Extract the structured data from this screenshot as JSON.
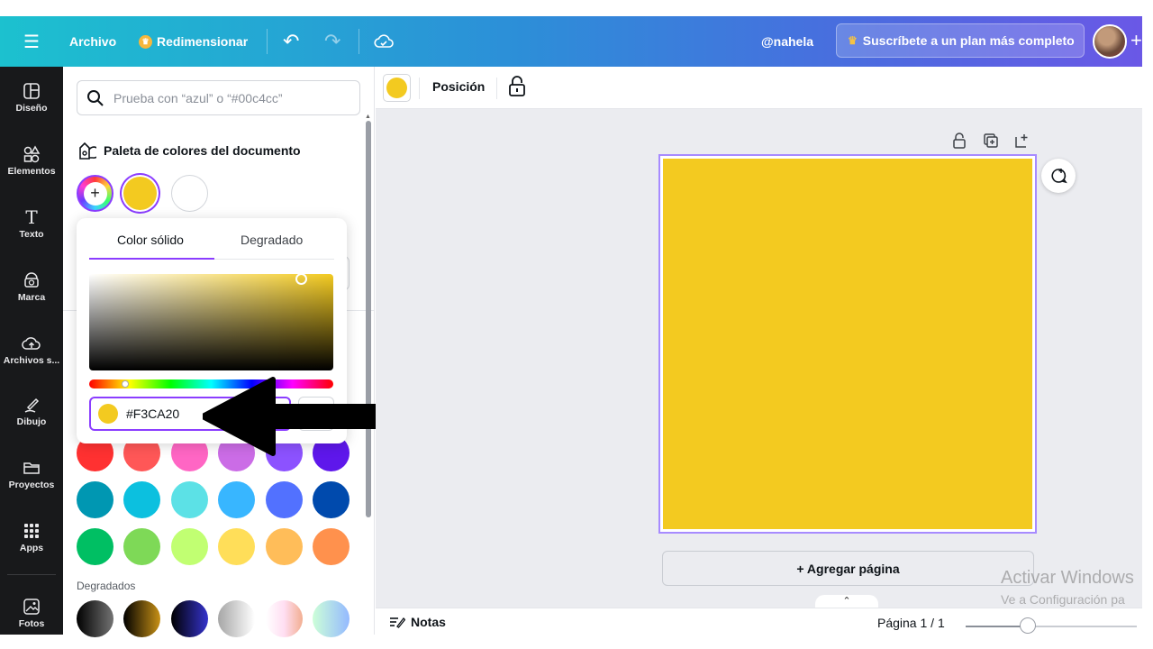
{
  "topbar": {
    "archivo": "Archivo",
    "redimensionar": "Redimensionar",
    "username": "@nahela",
    "subscribe": "Suscríbete a un plan más completo"
  },
  "sidebar": {
    "items": [
      {
        "label": "Diseño",
        "icon": "layout-icon"
      },
      {
        "label": "Elementos",
        "icon": "shapes-icon"
      },
      {
        "label": "Texto",
        "icon": "text-icon"
      },
      {
        "label": "Marca",
        "icon": "brand-icon"
      },
      {
        "label": "Archivos s...",
        "icon": "cloud-upload-icon"
      },
      {
        "label": "Dibujo",
        "icon": "pen-icon"
      },
      {
        "label": "Proyectos",
        "icon": "folder-icon"
      },
      {
        "label": "Apps",
        "icon": "apps-grid-icon"
      },
      {
        "label": "Fotos",
        "icon": "image-icon"
      }
    ]
  },
  "panel": {
    "search_placeholder": "Prueba con “azul” o “#00c4cc”",
    "palette_title": "Paleta de colores del documento",
    "degradados_label": "Degradados",
    "document_colors": [
      "#f3ca20",
      "#ffffff"
    ],
    "default_colors": [
      [
        "#ff3131",
        "#ff5757",
        "#ff66c4",
        "#cb6ce6",
        "#8c52ff",
        "#5e17eb"
      ],
      [
        "#0097b2",
        "#0cc0df",
        "#5ce1e6",
        "#38b6ff",
        "#5271ff",
        "#004aad"
      ],
      [
        "#00bf63",
        "#7ed957",
        "#c1ff72",
        "#ffde59",
        "#ffbd59",
        "#ff914d"
      ]
    ]
  },
  "picker": {
    "tab_solid": "Color sólido",
    "tab_gradient": "Degradado",
    "hex_value": "#F3CA20"
  },
  "annotation": {
    "text": "#F3CA20"
  },
  "context_toolbar": {
    "position_label": "Posición"
  },
  "canvas": {
    "page_color": "#f3ca20",
    "add_page": "+ Agregar página"
  },
  "watermark": {
    "line1": "Activar Windows",
    "line2": "Ve a Configuración pa"
  },
  "footer": {
    "notes": "Notas",
    "page_indicator": "Página 1 / 1"
  }
}
